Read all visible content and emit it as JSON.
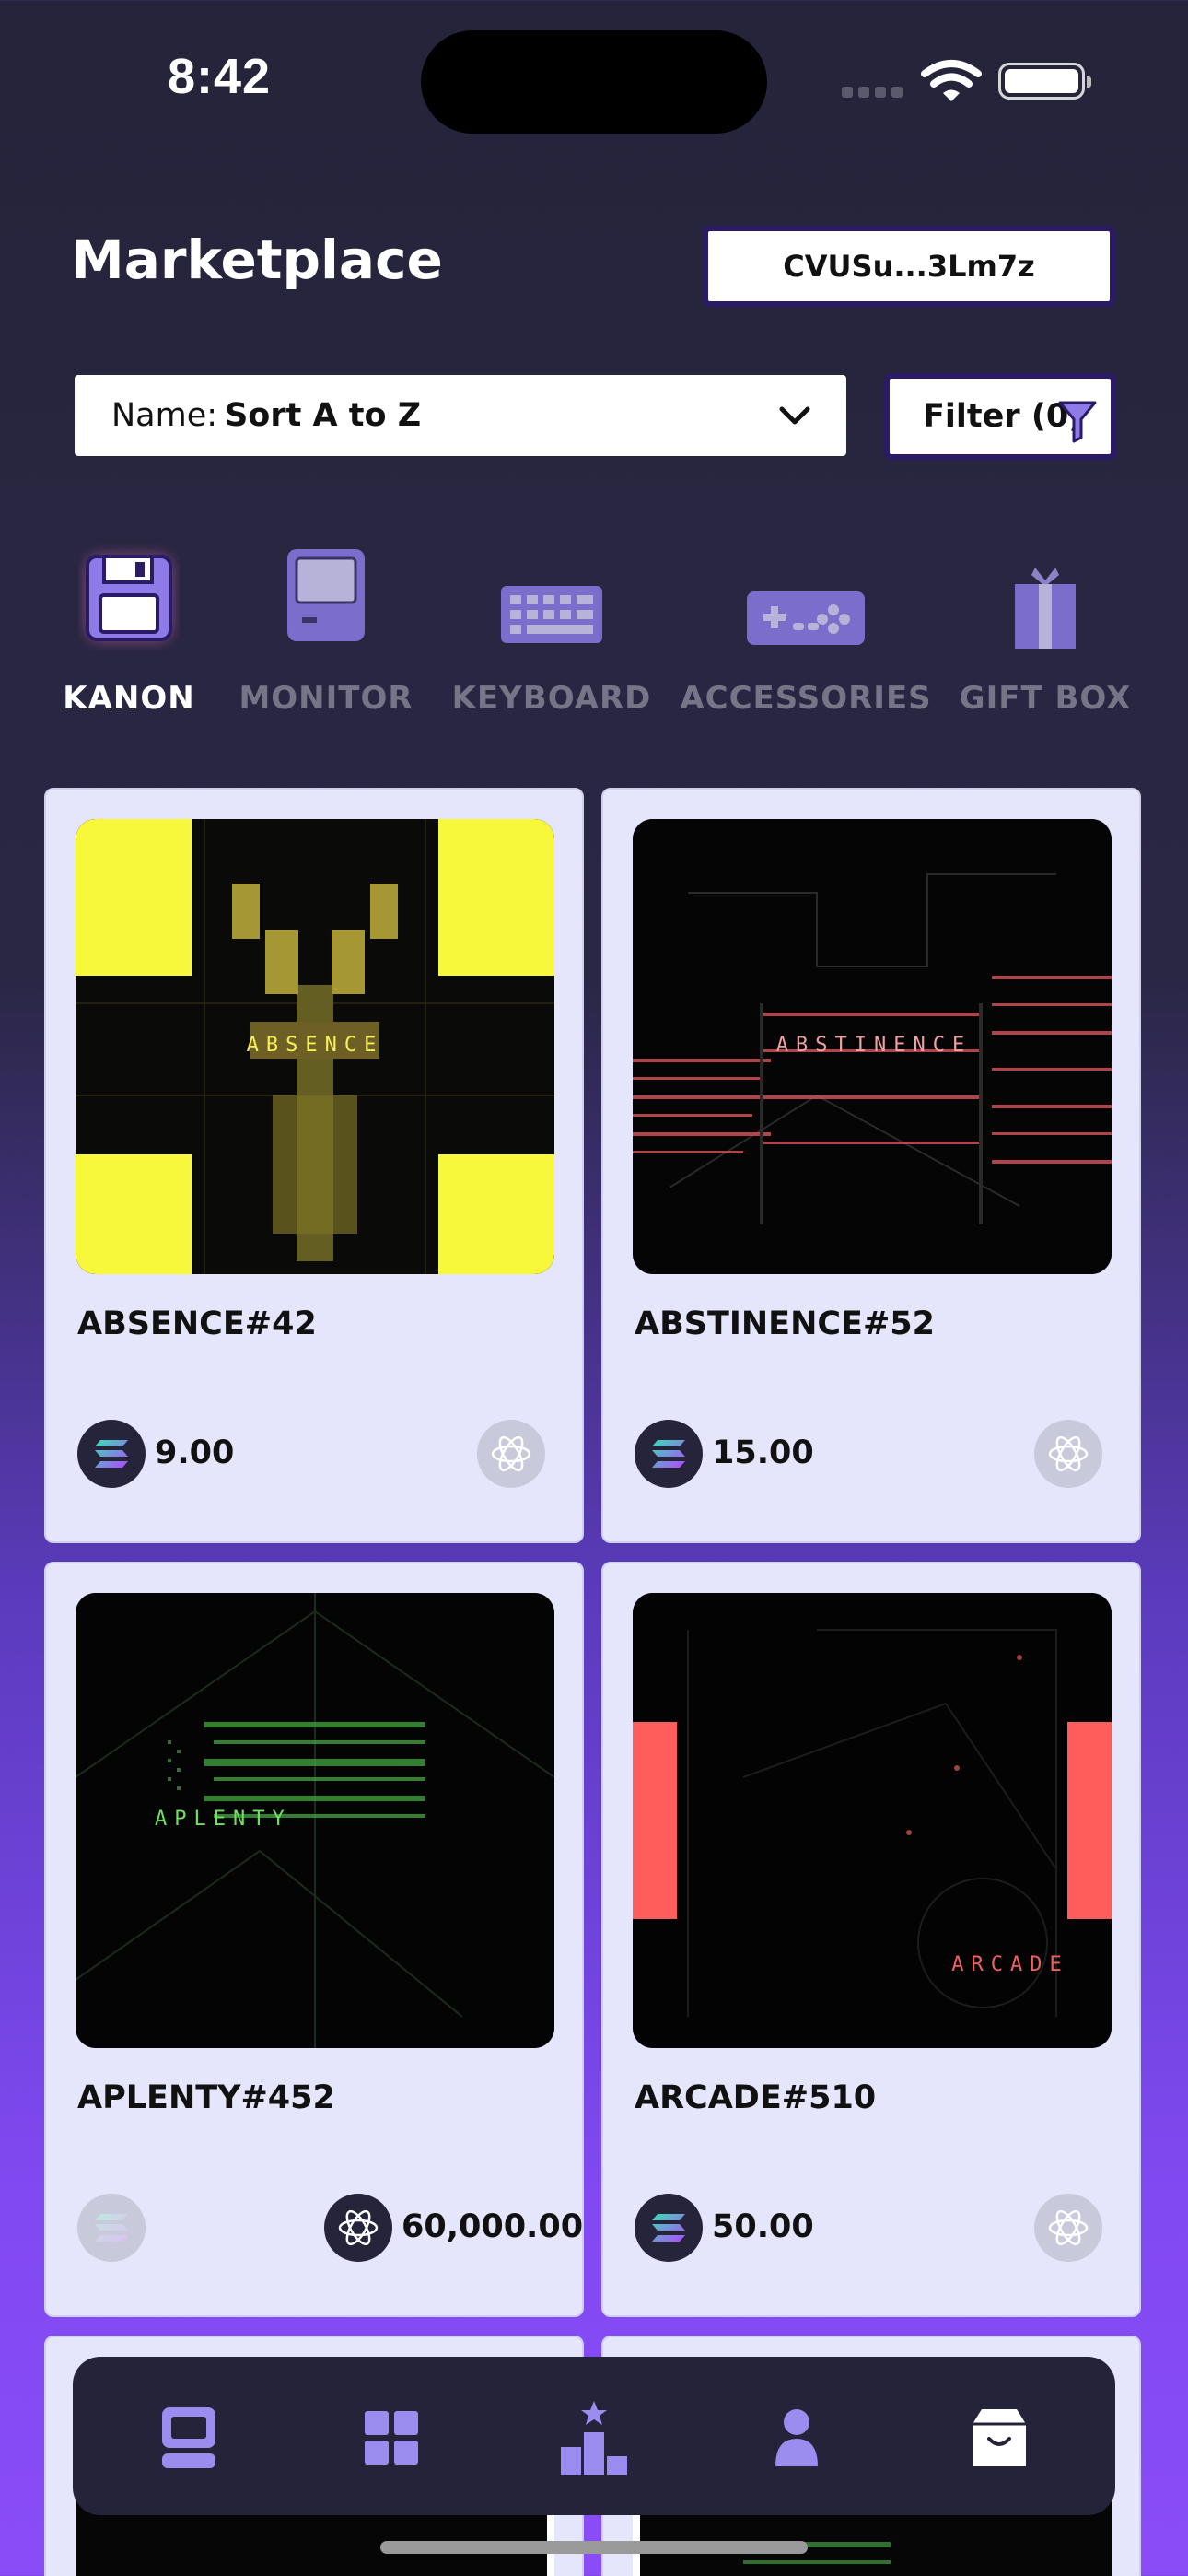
{
  "status_bar": {
    "time": "8:42"
  },
  "header": {
    "title": "Marketplace",
    "wallet_address": "CVUSu...3Lm7z"
  },
  "sort": {
    "prefix": "Name:",
    "value": "Sort A to Z"
  },
  "filter": {
    "label": "Filter (0)"
  },
  "categories": [
    {
      "label": "KANON",
      "icon": "floppy-disk-icon",
      "active": true
    },
    {
      "label": "MONITOR",
      "icon": "computer-icon",
      "active": false
    },
    {
      "label": "KEYBOARD",
      "icon": "keyboard-icon",
      "active": false
    },
    {
      "label": "ACCESSORIES",
      "icon": "gamepad-icon",
      "active": false
    },
    {
      "label": "GIFT BOX",
      "icon": "gift-box-icon",
      "active": false
    }
  ],
  "items": [
    {
      "name": "ABSENCE#42",
      "art_text": "ABSENCE",
      "price": "9.00",
      "currency": "solana",
      "accent": "#f5f53a"
    },
    {
      "name": "ABSTINENCE#52",
      "art_text": "ABSTINENCE",
      "price": "15.00",
      "currency": "solana",
      "accent": "#e0585f"
    },
    {
      "name": "APLENTY#452",
      "art_text": "APLENTY",
      "price": "60,000.00",
      "currency": "atom",
      "accent": "#5fd24b"
    },
    {
      "name": "ARCADE#510",
      "art_text": "ARCADE",
      "price": "50.00",
      "currency": "solana",
      "accent": "#f05c5c"
    }
  ],
  "bottom_nav": [
    {
      "name": "computer-icon"
    },
    {
      "name": "grid-icon"
    },
    {
      "name": "leaderboard-icon"
    },
    {
      "name": "profile-icon"
    },
    {
      "name": "shop-bag-icon"
    }
  ],
  "colors": {
    "accent_purple": "#9b8cf0",
    "card_bg": "#e5e5fb",
    "nav_bg": "#24233a"
  }
}
